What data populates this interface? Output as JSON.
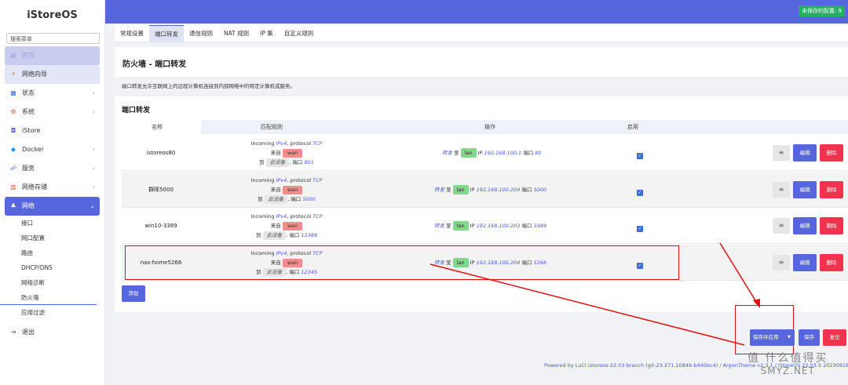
{
  "sidebar": {
    "logo": "iStoreOS",
    "search_placeholder": "搜索菜单",
    "items": [
      {
        "label": "首页"
      },
      {
        "label": "网络向导"
      },
      {
        "label": "状态"
      },
      {
        "label": "系统"
      },
      {
        "label": "iStore"
      },
      {
        "label": "Docker"
      },
      {
        "label": "服务"
      },
      {
        "label": "网络存储"
      },
      {
        "label": "网络"
      }
    ],
    "subitems": [
      {
        "label": "接口"
      },
      {
        "label": "网口配置"
      },
      {
        "label": "路由"
      },
      {
        "label": "DHCP/DNS"
      },
      {
        "label": "网络诊断"
      },
      {
        "label": "防火墙"
      },
      {
        "label": "应用过滤"
      }
    ],
    "logout": "退出"
  },
  "header": {
    "unsaved": "未保存的配置: 9"
  },
  "tabs": [
    {
      "label": "常规设置"
    },
    {
      "label": "端口转发"
    },
    {
      "label": "通信规则"
    },
    {
      "label": "NAT 规则"
    },
    {
      "label": "IP 集"
    },
    {
      "label": "自定义规则"
    }
  ],
  "page": {
    "title": "防火墙 - 端口转发",
    "description": "端口转发允许互联网上的远程计算机连接到内部网络中的特定计算机或服务。",
    "section_title": "端口转发"
  },
  "table": {
    "headers": {
      "name": "名称",
      "match": "匹配规则",
      "action": "操作",
      "enabled": "启用"
    },
    "rows": [
      {
        "name": "istoreos80",
        "in": "Incoming",
        "ipv": "IPv4",
        "proto_label": ", protocol",
        "proto": "TCP",
        "from": "来自",
        "zone": "wan",
        "to": "到",
        "dev": "此设备",
        "port_label": ", 端口",
        "port": "801",
        "fwd": "转发",
        "fwd_to": "至",
        "lan": "lan",
        "ip_label": "IP",
        "ip": "192.168.100.1",
        "dport_label": "端口",
        "dport": "80",
        "enabled": "✓"
      },
      {
        "name": "群晖5000",
        "in": "Incoming",
        "ipv": "IPv4",
        "proto_label": ", protocol",
        "proto": "TCP",
        "from": "来自",
        "zone": "wan",
        "to": "到",
        "dev": "此设备",
        "port_label": ", 端口",
        "port": "5000",
        "fwd": "转发",
        "fwd_to": "至",
        "lan": "lan",
        "ip_label": "IP",
        "ip": "192.168.100.204",
        "dport_label": "端口",
        "dport": "5000",
        "enabled": "✓"
      },
      {
        "name": "win10-3389",
        "in": "Incoming",
        "ipv": "IPv4",
        "proto_label": ", protocol",
        "proto": "TCP",
        "from": "来自",
        "zone": "wan",
        "to": "到",
        "dev": "此设备",
        "port_label": ", 端口",
        "port": "13389",
        "fwd": "转发",
        "fwd_to": "至",
        "lan": "lan",
        "ip_label": "IP",
        "ip": "192.168.100.203",
        "dport_label": "端口",
        "dport": "3389",
        "enabled": "✓"
      },
      {
        "name": "nas-home5266",
        "in": "Incoming",
        "ipv": "IPv4",
        "proto_label": ", protocol",
        "proto": "TCP",
        "from": "来自",
        "zone": "wan",
        "to": "到",
        "dev": "此设备",
        "port_label": ", 端口",
        "port": "12345",
        "fwd": "转发",
        "fwd_to": "至",
        "lan": "lan",
        "ip_label": "IP",
        "ip": "192.168.100.204",
        "dport_label": "端口",
        "dport": "5266",
        "enabled": "✓"
      }
    ],
    "more_label": "≡",
    "edit_label": "编辑",
    "delete_label": "删除",
    "add_label": "添加"
  },
  "footer": {
    "apply_label": "保存并应用",
    "save_label": "保存",
    "reset_label": "复位",
    "powered": "Powered by LuCI istoreos-22.03 branch (git-23.271.10849-b445bc4) / ArgonTheme v2.3.1 / iStoreOS 22.03.5 2023091815"
  },
  "watermark": {
    "cn": "值 什么值得买",
    "en": "SMYZ.NET"
  }
}
